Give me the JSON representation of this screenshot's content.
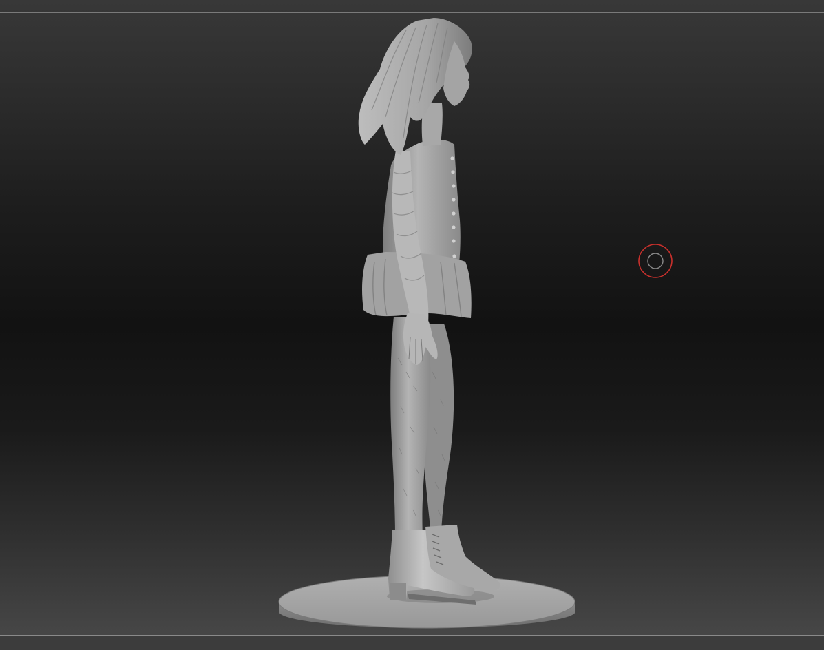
{
  "viewport": {
    "background_top": "#383838",
    "background_mid": "#121212",
    "background_bottom": "#4a4a4a"
  },
  "model": {
    "material_color": "#a9a9a9",
    "base_color": "#9e9e9e"
  },
  "cursor": {
    "icon": "brush-cursor-icon",
    "color": "#c8302c"
  }
}
